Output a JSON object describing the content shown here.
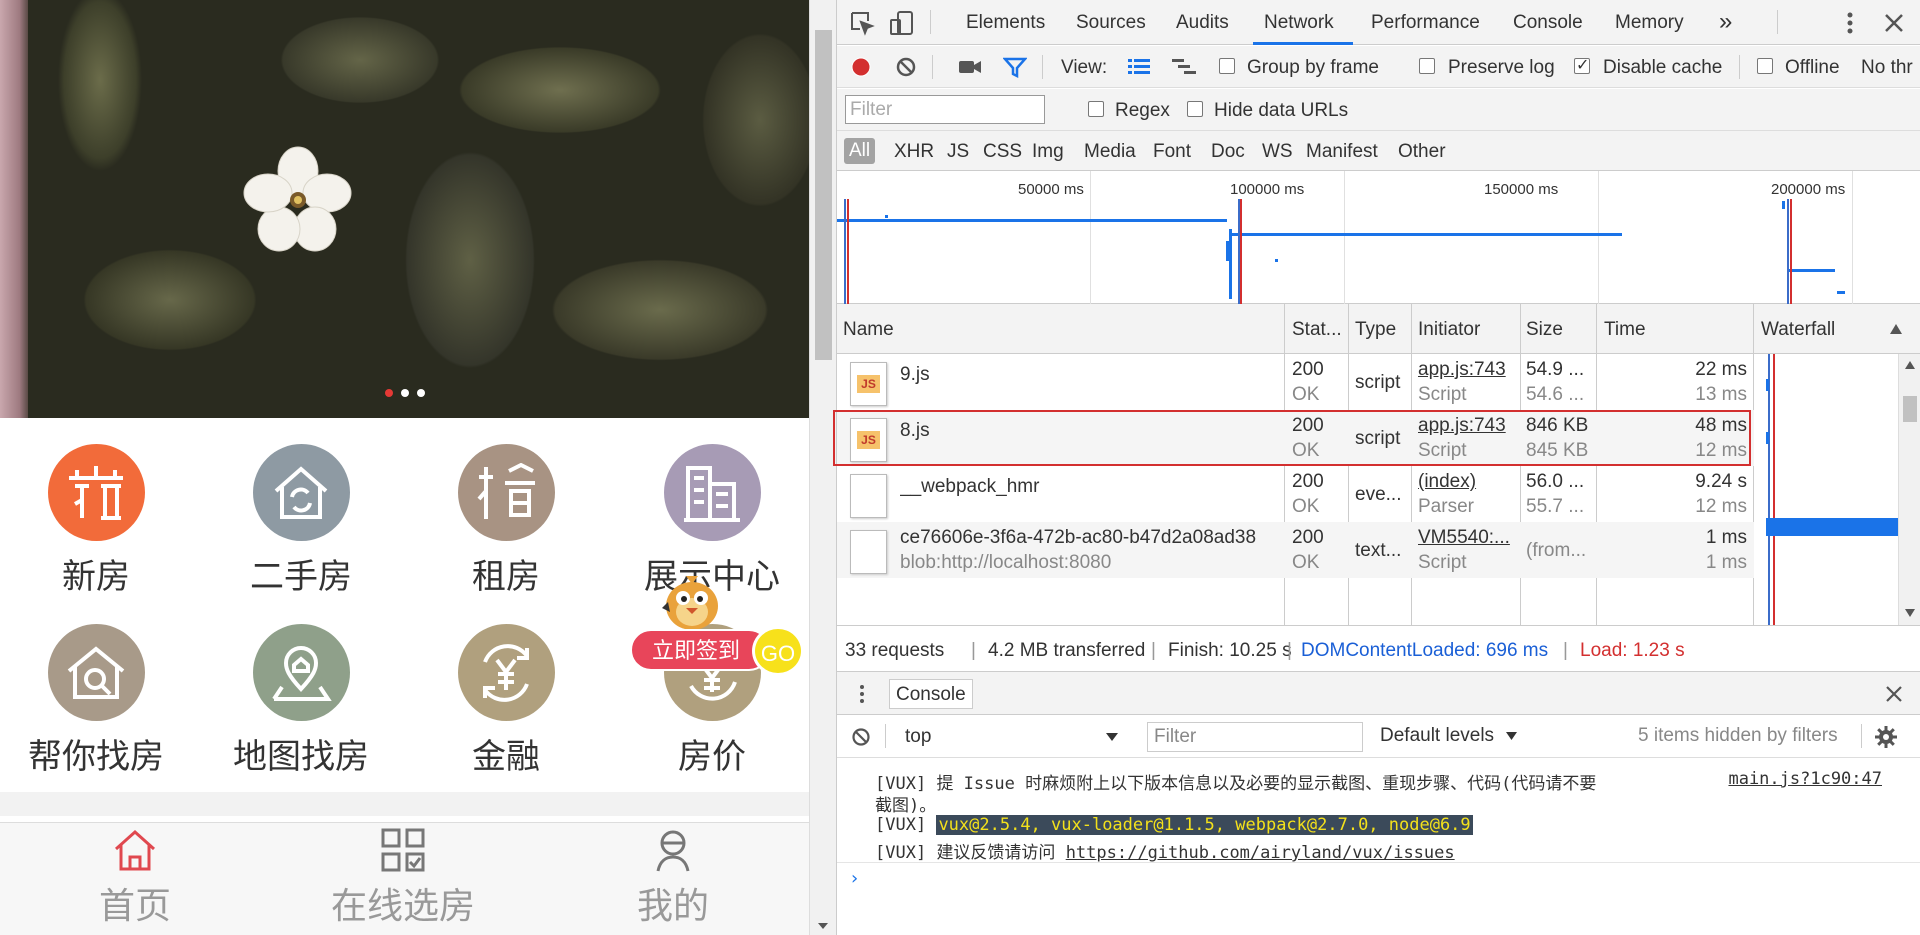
{
  "mobile": {
    "grid": [
      {
        "label": "新房",
        "color": "#f26b3a",
        "icon": "new-house-icon"
      },
      {
        "label": "二手房",
        "color": "#8e9aa3",
        "icon": "second-hand-house-icon"
      },
      {
        "label": "租房",
        "color": "#a89383",
        "icon": "rent-house-icon"
      },
      {
        "label": "展示中心",
        "color": "#a79bb5",
        "icon": "showcase-building-icon"
      },
      {
        "label": "帮你找房",
        "color": "#a89a89",
        "icon": "search-house-icon"
      },
      {
        "label": "地图找房",
        "color": "#8fa08a",
        "icon": "map-pin-icon"
      },
      {
        "label": "金融",
        "color": "#b0a07e",
        "icon": "yuan-finance-icon"
      },
      {
        "label": "房价",
        "color": "#b0a07e",
        "icon": "house-price-icon"
      }
    ],
    "signin": {
      "label": "立即签到",
      "go": "GO"
    },
    "tabs": [
      {
        "label": "首页",
        "active": true,
        "icon": "home-icon"
      },
      {
        "label": "在线选房",
        "active": false,
        "icon": "grid-select-icon"
      },
      {
        "label": "我的",
        "active": false,
        "icon": "user-icon"
      }
    ]
  },
  "devtools": {
    "tabs": [
      "Elements",
      "Sources",
      "Audits",
      "Network",
      "Performance",
      "Console",
      "Memory"
    ],
    "active_tab": "Network",
    "more": "»",
    "toolbar": {
      "view_label": "View:",
      "group_by_frame": "Group by frame",
      "preserve_log": "Preserve log",
      "disable_cache": "Disable cache",
      "offline": "Offline",
      "throttle": "No thr"
    },
    "filter": {
      "placeholder": "Filter",
      "regex": "Regex",
      "hide_data_urls": "Hide data URLs"
    },
    "type_filters": [
      "All",
      "XHR",
      "JS",
      "CSS",
      "Img",
      "Media",
      "Font",
      "Doc",
      "WS",
      "Manifest",
      "Other"
    ],
    "timeline_ticks": [
      "50000 ms",
      "100000 ms",
      "150000 ms",
      "200000 ms"
    ],
    "columns": [
      "Name",
      "Stat...",
      "Type",
      "Initiator",
      "Size",
      "Time",
      "Waterfall"
    ],
    "rows": [
      {
        "name": "9.js",
        "sub": "",
        "status": "200",
        "status_text": "OK",
        "type": "script",
        "initiator": "app.js:743",
        "initiator_sub": "Script",
        "size": "54.9 ...",
        "size_sub": "54.6 ...",
        "time": "22 ms",
        "time_sub": "13 ms",
        "js": true
      },
      {
        "name": "8.js",
        "sub": "",
        "status": "200",
        "status_text": "OK",
        "type": "script",
        "initiator": "app.js:743",
        "initiator_sub": "Script",
        "size": "846 KB",
        "size_sub": "845 KB",
        "time": "48 ms",
        "time_sub": "12 ms",
        "js": true
      },
      {
        "name": "__webpack_hmr",
        "sub": "",
        "status": "200",
        "status_text": "OK",
        "type": "eve...",
        "initiator": "(index)",
        "initiator_sub": "Parser",
        "size": "56.0 ...",
        "size_sub": "55.7 ...",
        "time": "9.24 s",
        "time_sub": "12 ms",
        "js": false
      },
      {
        "name": "ce76606e-3f6a-472b-ac80-b47d2a08ad38",
        "sub": "blob:http://localhost:8080",
        "status": "200",
        "status_text": "OK",
        "type": "text...",
        "initiator": "VM5540:...",
        "initiator_sub": "Script",
        "size": "(from...",
        "size_sub": "",
        "time": "1 ms",
        "time_sub": "1 ms",
        "js": false
      }
    ],
    "summary": {
      "requests": "33 requests",
      "transferred": "4.2 MB transferred",
      "finish": "Finish: 10.25 s",
      "dom": "DOMContentLoaded: 696 ms",
      "load": "Load: 1.23 s"
    },
    "console": {
      "tab": "Console",
      "context": "top",
      "filter_placeholder": "Filter",
      "levels": "Default levels",
      "hidden": "5 items hidden by filters",
      "lines": [
        {
          "prefix": "[VUX]",
          "text": "提 Issue 时麻烦附上以下版本信息以及必要的显示截图、重现步骤、代码(代码请不要",
          "src": "main.js?1c90:47"
        },
        {
          "prefix": "",
          "text": "截图)。",
          "src": ""
        },
        {
          "prefix": "[VUX]",
          "text": "vux@2.5.4, vux-loader@1.1.5, webpack@2.7.0, node@6.9",
          "src": ""
        },
        {
          "prefix": "[VUX]",
          "text": "建议反馈请访问",
          "link": "https://github.com/airyland/vux/issues",
          "src": ""
        }
      ]
    }
  }
}
